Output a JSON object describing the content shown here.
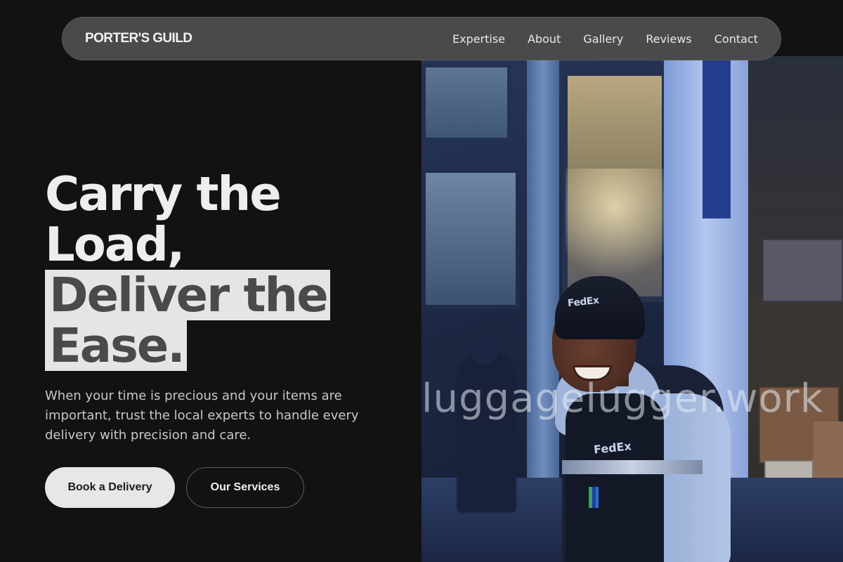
{
  "nav": {
    "brand": "PORTER'S GUILD",
    "links": [
      "Expertise",
      "About",
      "Gallery",
      "Reviews",
      "Contact"
    ]
  },
  "hero": {
    "headline_line1": "Carry the",
    "headline_line2": "Load,",
    "headline_line3": "Deliver the",
    "headline_line4": "Ease.",
    "subtext": "When your time is precious and your items are important, trust the local experts to handle every delivery with precision and care.",
    "primary_button": "Book a Delivery",
    "secondary_button": "Our Services"
  },
  "photo": {
    "watermark": "luggagelugger.work",
    "beanie_logo": "FedEx",
    "vest_logo": "FedEx"
  },
  "colors": {
    "background": "#121213",
    "nav_bg": "#4a4a4a",
    "highlight_bg": "#e5e5e5",
    "highlight_text": "#4a4a4a"
  }
}
